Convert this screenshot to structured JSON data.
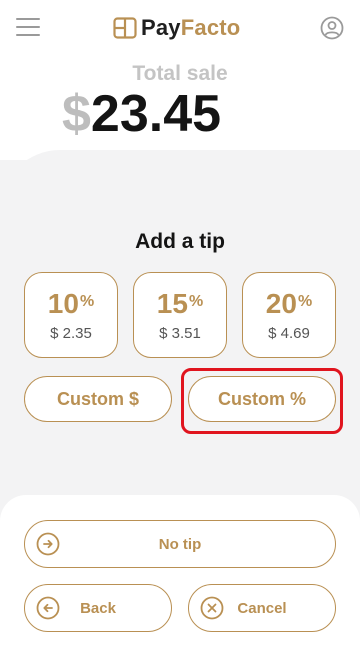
{
  "header": {
    "brand_first": "Pay",
    "brand_second": "Facto"
  },
  "sale": {
    "label": "Total sale",
    "currency": "$",
    "amount": "23.45"
  },
  "tip": {
    "title": "Add a tip",
    "options": [
      {
        "percent": "10",
        "percent_sign": "%",
        "amount": "$ 2.35"
      },
      {
        "percent": "15",
        "percent_sign": "%",
        "amount": "$ 3.51"
      },
      {
        "percent": "20",
        "percent_sign": "%",
        "amount": "$ 4.69"
      }
    ],
    "custom_dollar_label": "Custom $",
    "custom_percent_label": "Custom %"
  },
  "actions": {
    "no_tip_label": "No tip",
    "back_label": "Back",
    "cancel_label": "Cancel"
  },
  "colors": {
    "accent": "#b99053",
    "highlight": "#e0141e",
    "background": "#f3f3f4"
  },
  "icons": {
    "menu": "hamburger-icon",
    "user": "user-circle-icon",
    "no_tip": "arrow-right-circle-icon",
    "back": "arrow-left-circle-icon",
    "cancel": "x-circle-icon"
  }
}
